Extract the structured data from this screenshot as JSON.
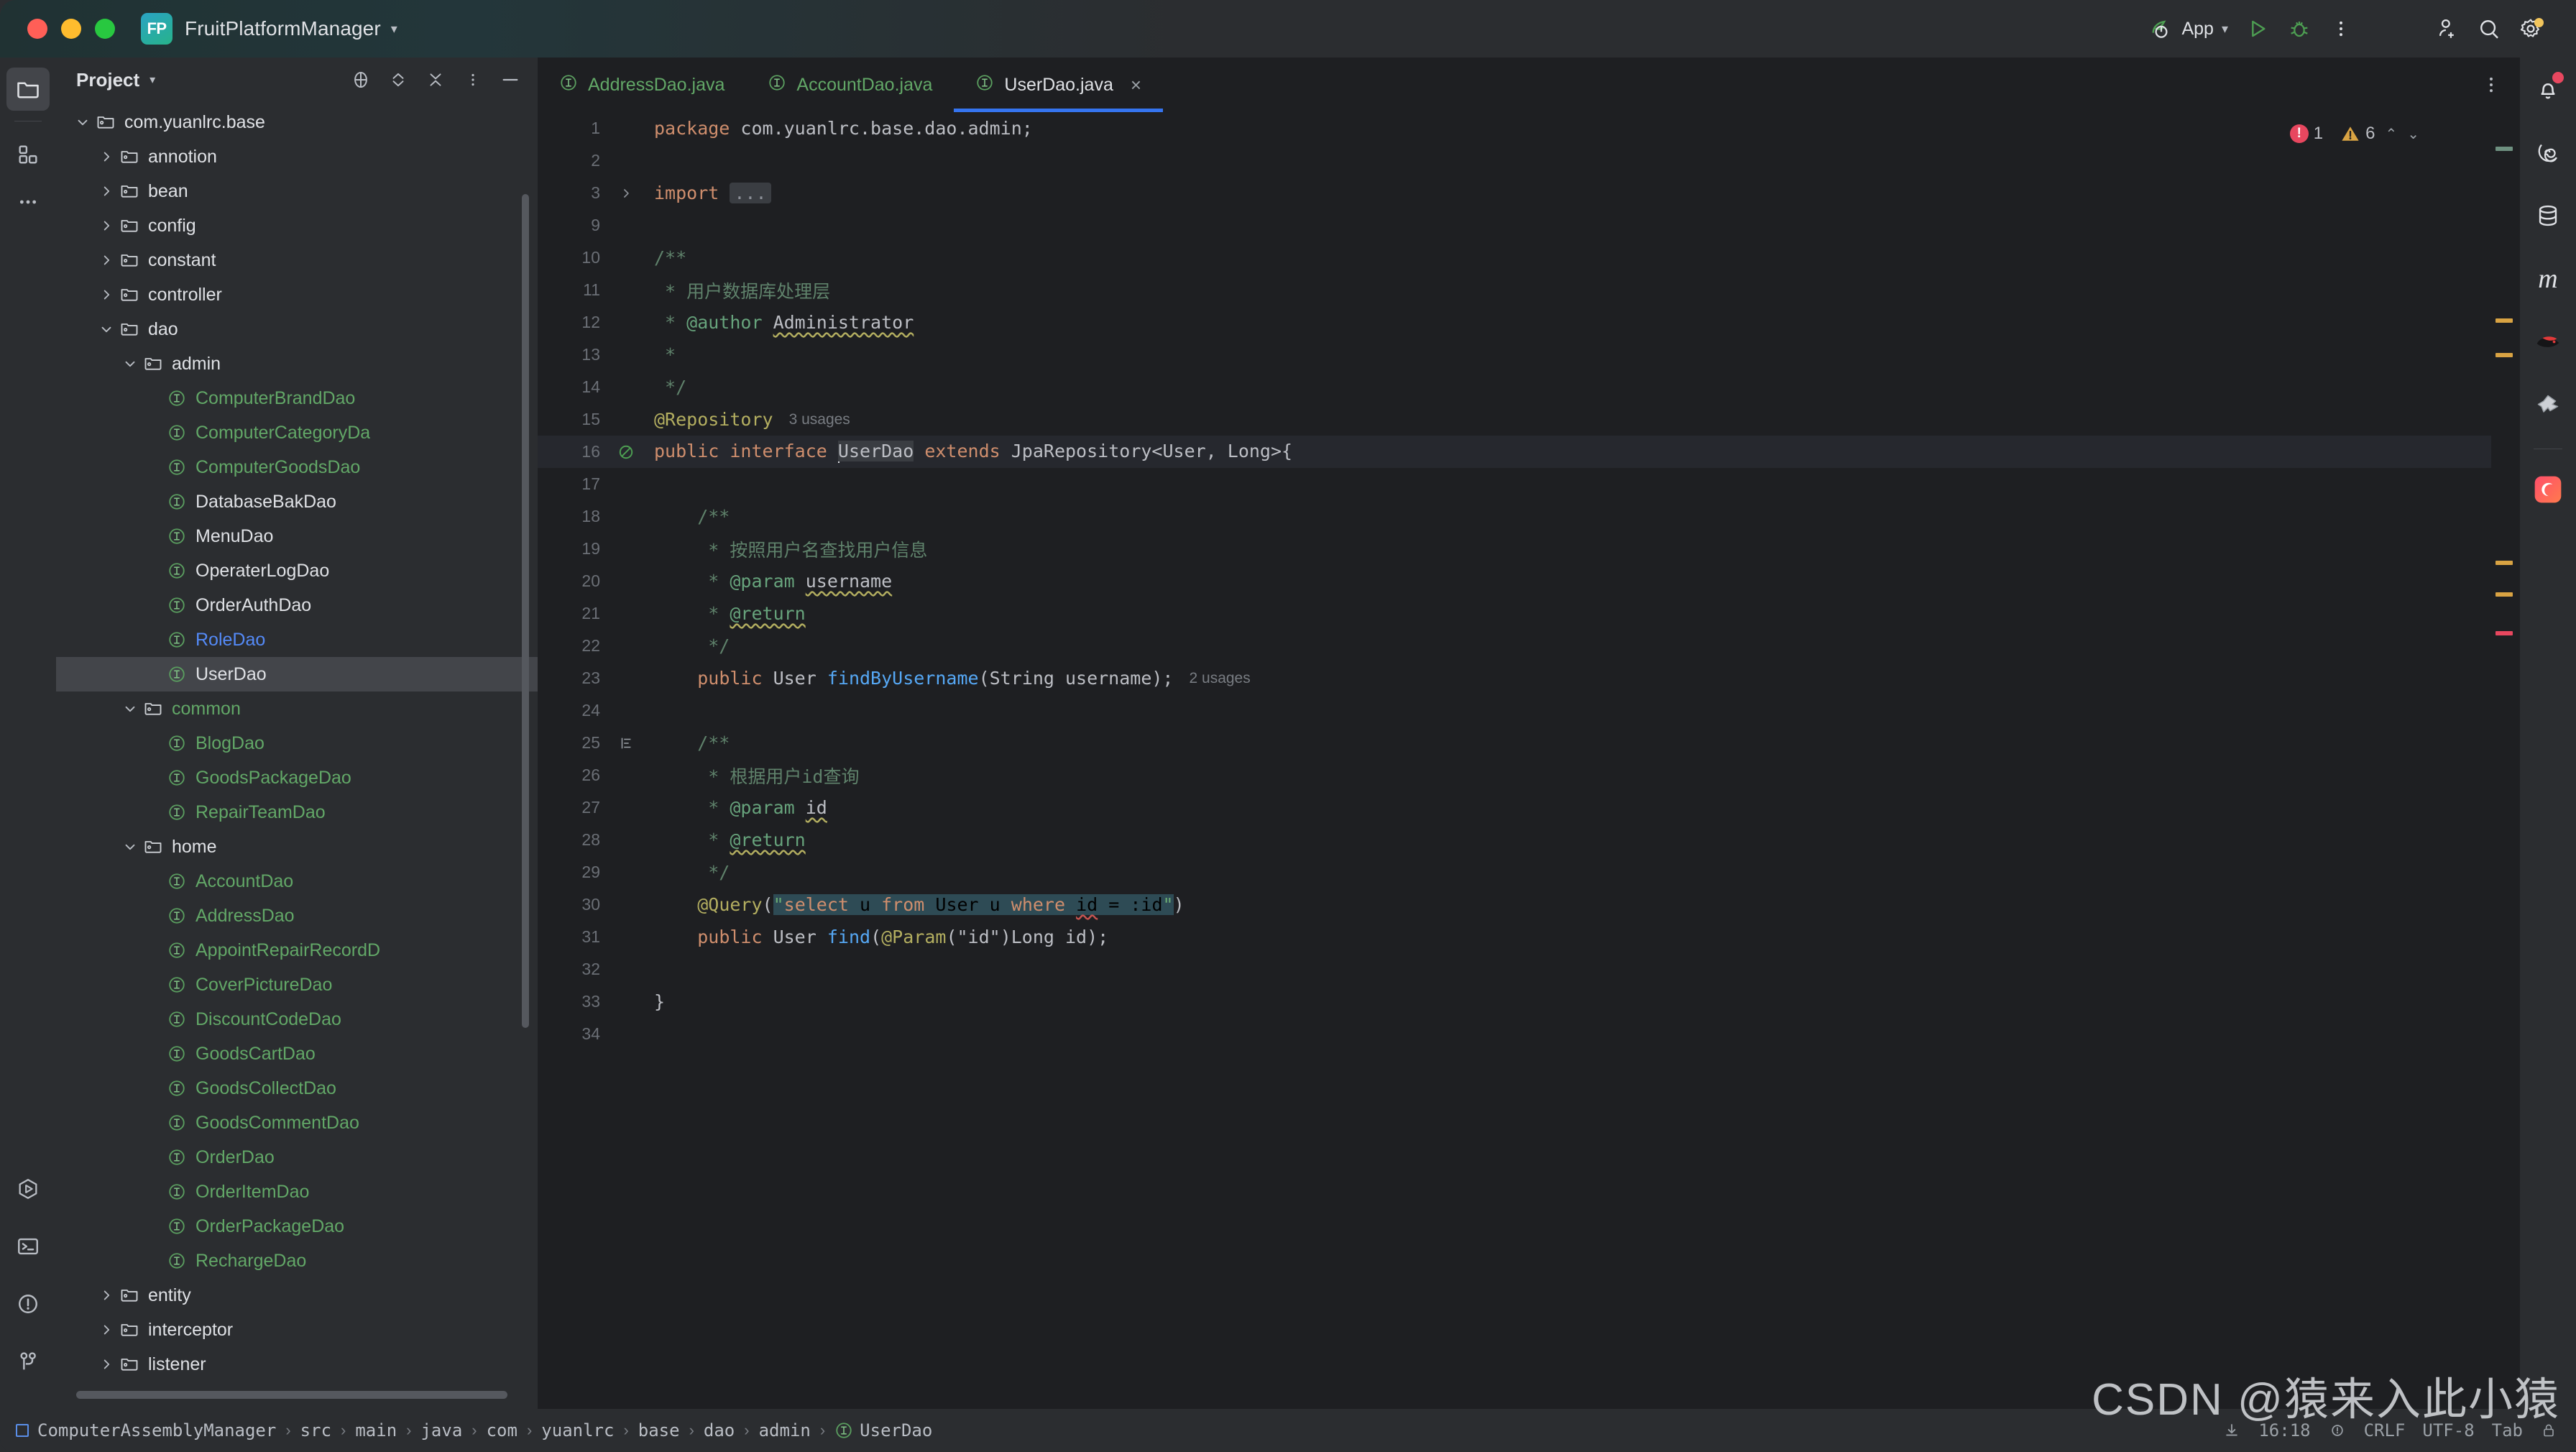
{
  "window": {
    "project_badge": "FP",
    "project_name": "FruitPlatformManager",
    "traffic_lights": [
      "close",
      "minimize",
      "maximize"
    ]
  },
  "toolbar": {
    "run_config_label": "App",
    "icons": [
      "spring-leaf-icon",
      "chevron-down-icon",
      "run-icon",
      "debug-icon",
      "more-vertical-icon",
      "add-user-icon",
      "search-icon",
      "settings-gear-icon"
    ]
  },
  "left_rail": {
    "items": [
      {
        "name": "project-tool-window",
        "icon": "folder-icon",
        "active": true
      },
      {
        "name": "structure-tool-window",
        "icon": "grid-squares-icon",
        "active": false
      },
      {
        "name": "more-tool-windows",
        "icon": "ellipsis-icon",
        "active": false
      }
    ],
    "bottom_items": [
      {
        "name": "run-tool-window",
        "icon": "run-hex-icon"
      },
      {
        "name": "terminal-tool-window",
        "icon": "terminal-icon"
      },
      {
        "name": "problems-tool-window",
        "icon": "warning-circle-icon"
      },
      {
        "name": "version-control-tool-window",
        "icon": "git-branch-icon"
      }
    ]
  },
  "right_rail": {
    "items": [
      {
        "name": "notifications",
        "icon": "bell-icon",
        "badge": true
      },
      {
        "name": "spiral-plugin",
        "icon": "spiral-icon"
      },
      {
        "name": "database",
        "icon": "database-icon"
      },
      {
        "name": "maven",
        "icon": "maven-m-icon"
      },
      {
        "name": "ninja-plugin",
        "icon": "ninja-icon"
      },
      {
        "name": "bundle-plugin",
        "icon": "origami-icon"
      },
      {
        "name": "ai-assistant",
        "icon": "ai-moon-icon"
      }
    ]
  },
  "project_panel": {
    "title": "Project",
    "tools": [
      "locate-target-icon",
      "expand-collapse-icon",
      "collapse-all-icon",
      "more-options-icon",
      "hide-panel-icon"
    ],
    "tree": [
      {
        "label": "com.yuanlrc.base",
        "type": "package",
        "indent": 0,
        "twisty": "down",
        "color": "white"
      },
      {
        "label": "annotion",
        "type": "package",
        "indent": 1,
        "twisty": "right",
        "color": "white"
      },
      {
        "label": "bean",
        "type": "package",
        "indent": 1,
        "twisty": "right",
        "color": "white"
      },
      {
        "label": "config",
        "type": "package",
        "indent": 1,
        "twisty": "right",
        "color": "white"
      },
      {
        "label": "constant",
        "type": "package",
        "indent": 1,
        "twisty": "right",
        "color": "white"
      },
      {
        "label": "controller",
        "type": "package",
        "indent": 1,
        "twisty": "right",
        "color": "white"
      },
      {
        "label": "dao",
        "type": "package",
        "indent": 1,
        "twisty": "down",
        "color": "white"
      },
      {
        "label": "admin",
        "type": "package",
        "indent": 2,
        "twisty": "down",
        "color": "white"
      },
      {
        "label": "ComputerBrandDao",
        "type": "interface",
        "indent": 3,
        "twisty": "",
        "color": "green"
      },
      {
        "label": "ComputerCategoryDa",
        "type": "interface",
        "indent": 3,
        "twisty": "",
        "color": "green"
      },
      {
        "label": "ComputerGoodsDao",
        "type": "interface",
        "indent": 3,
        "twisty": "",
        "color": "green"
      },
      {
        "label": "DatabaseBakDao",
        "type": "interface",
        "indent": 3,
        "twisty": "",
        "color": "white"
      },
      {
        "label": "MenuDao",
        "type": "interface",
        "indent": 3,
        "twisty": "",
        "color": "white"
      },
      {
        "label": "OperaterLogDao",
        "type": "interface",
        "indent": 3,
        "twisty": "",
        "color": "white"
      },
      {
        "label": "OrderAuthDao",
        "type": "interface",
        "indent": 3,
        "twisty": "",
        "color": "white"
      },
      {
        "label": "RoleDao",
        "type": "interface",
        "indent": 3,
        "twisty": "",
        "color": "blue"
      },
      {
        "label": "UserDao",
        "type": "interface",
        "indent": 3,
        "twisty": "",
        "color": "white",
        "selected": true
      },
      {
        "label": "common",
        "type": "package",
        "indent": 2,
        "twisty": "down",
        "color": "green"
      },
      {
        "label": "BlogDao",
        "type": "interface",
        "indent": 3,
        "twisty": "",
        "color": "green"
      },
      {
        "label": "GoodsPackageDao",
        "type": "interface",
        "indent": 3,
        "twisty": "",
        "color": "green"
      },
      {
        "label": "RepairTeamDao",
        "type": "interface",
        "indent": 3,
        "twisty": "",
        "color": "green"
      },
      {
        "label": "home",
        "type": "package",
        "indent": 2,
        "twisty": "down",
        "color": "white"
      },
      {
        "label": "AccountDao",
        "type": "interface",
        "indent": 3,
        "twisty": "",
        "color": "green"
      },
      {
        "label": "AddressDao",
        "type": "interface",
        "indent": 3,
        "twisty": "",
        "color": "green"
      },
      {
        "label": "AppointRepairRecordD",
        "type": "interface",
        "indent": 3,
        "twisty": "",
        "color": "green"
      },
      {
        "label": "CoverPictureDao",
        "type": "interface",
        "indent": 3,
        "twisty": "",
        "color": "green"
      },
      {
        "label": "DiscountCodeDao",
        "type": "interface",
        "indent": 3,
        "twisty": "",
        "color": "green"
      },
      {
        "label": "GoodsCartDao",
        "type": "interface",
        "indent": 3,
        "twisty": "",
        "color": "green"
      },
      {
        "label": "GoodsCollectDao",
        "type": "interface",
        "indent": 3,
        "twisty": "",
        "color": "green"
      },
      {
        "label": "GoodsCommentDao",
        "type": "interface",
        "indent": 3,
        "twisty": "",
        "color": "green"
      },
      {
        "label": "OrderDao",
        "type": "interface",
        "indent": 3,
        "twisty": "",
        "color": "green"
      },
      {
        "label": "OrderItemDao",
        "type": "interface",
        "indent": 3,
        "twisty": "",
        "color": "green"
      },
      {
        "label": "OrderPackageDao",
        "type": "interface",
        "indent": 3,
        "twisty": "",
        "color": "green"
      },
      {
        "label": "RechargeDao",
        "type": "interface",
        "indent": 3,
        "twisty": "",
        "color": "green"
      },
      {
        "label": "entity",
        "type": "package",
        "indent": 1,
        "twisty": "right",
        "color": "white"
      },
      {
        "label": "interceptor",
        "type": "package",
        "indent": 1,
        "twisty": "right",
        "color": "white"
      },
      {
        "label": "listener",
        "type": "package",
        "indent": 1,
        "twisty": "right",
        "color": "white"
      }
    ]
  },
  "editor": {
    "tabs": [
      {
        "label": "AddressDao.java",
        "active": false,
        "closable": false
      },
      {
        "label": "AccountDao.java",
        "active": false,
        "closable": false
      },
      {
        "label": "UserDao.java",
        "active": true,
        "closable": true
      }
    ],
    "tab_close_glyph": "×",
    "more_icon": "more-vertical-icon",
    "inspections": {
      "error_count": "1",
      "warning_count": "6",
      "up_glyph": "⌃",
      "down_glyph": "⌄"
    },
    "lines": [
      {
        "n": "1",
        "text": "package com.yuanlrc.base.dao.admin;"
      },
      {
        "n": "2",
        "text": ""
      },
      {
        "n": "3",
        "text": "import ..."
      },
      {
        "n": "9",
        "text": ""
      },
      {
        "n": "10",
        "text": "/**"
      },
      {
        "n": "11",
        "text": " * 用户数据库处理层"
      },
      {
        "n": "12",
        "text": " * @author Administrator"
      },
      {
        "n": "13",
        "text": " *"
      },
      {
        "n": "14",
        "text": " */"
      },
      {
        "n": "15",
        "text": "@Repository",
        "usages": "3 usages"
      },
      {
        "n": "16",
        "text": "public interface UserDao extends JpaRepository<User, Long>{"
      },
      {
        "n": "17",
        "text": ""
      },
      {
        "n": "18",
        "text": "    /**"
      },
      {
        "n": "19",
        "text": "     * 按照用户名查找用户信息"
      },
      {
        "n": "20",
        "text": "     * @param username"
      },
      {
        "n": "21",
        "text": "     * @return"
      },
      {
        "n": "22",
        "text": "     */"
      },
      {
        "n": "23",
        "text": "    public User findByUsername(String username);",
        "usages": "2 usages"
      },
      {
        "n": "24",
        "text": ""
      },
      {
        "n": "25",
        "text": "    /**"
      },
      {
        "n": "26",
        "text": "     * 根据用户id查询"
      },
      {
        "n": "27",
        "text": "     * @param id"
      },
      {
        "n": "28",
        "text": "     * @return"
      },
      {
        "n": "29",
        "text": "     */"
      },
      {
        "n": "30",
        "text": "    @Query(\"select u from User u where id = :id\")"
      },
      {
        "n": "31",
        "text": "    public User find(@Param(\"id\")Long id);"
      },
      {
        "n": "32",
        "text": ""
      },
      {
        "n": "33",
        "text": "}"
      },
      {
        "n": "34",
        "text": ""
      }
    ]
  },
  "status_bar": {
    "breadcrumbs": [
      "ComputerAssemblyManager",
      "src",
      "main",
      "java",
      "com",
      "yuanlrc",
      "base",
      "dao",
      "admin",
      "UserDao"
    ],
    "separator": "›",
    "right": {
      "download_icon": "download-icon",
      "time": "16:18",
      "inspection_icon": "inspection-eye-icon",
      "line_separator": "CRLF",
      "encoding": "UTF-8",
      "indent": "Tab",
      "lock_icon": "lock-icon"
    }
  },
  "watermark": "CSDN @猿来入此小猿"
}
